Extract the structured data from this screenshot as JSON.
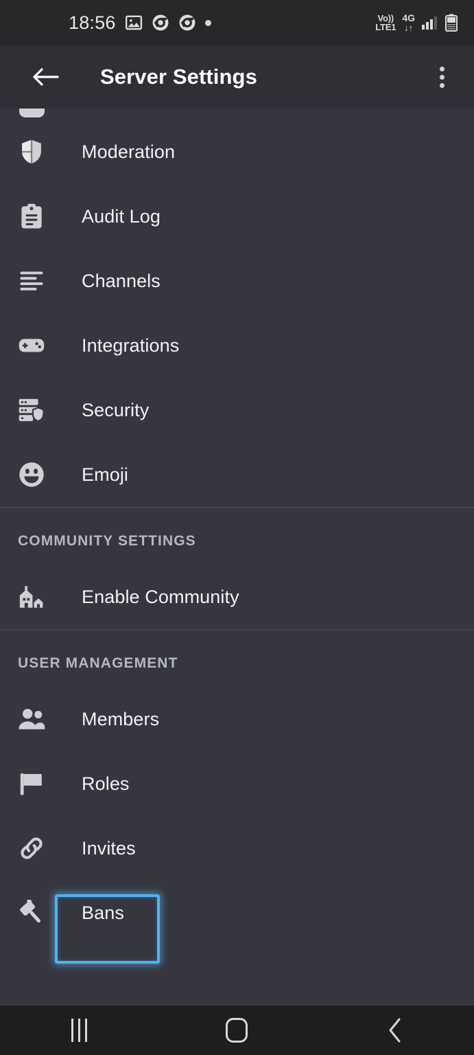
{
  "status_bar": {
    "time": "18:56",
    "icons": [
      "photo-icon",
      "chrome-icon",
      "chrome-icon",
      "dot-indicator"
    ],
    "carrier_line1": "Vo))",
    "carrier_line2": "LTE1",
    "network_type": "4G",
    "data_arrows": "↓↑",
    "signal": "signal-bars-icon",
    "battery": "battery-icon"
  },
  "header": {
    "back_icon": "arrow-left-icon",
    "title": "Server Settings",
    "overflow_icon": "more-vertical-icon"
  },
  "list": {
    "top_items": [
      {
        "label": "Moderation",
        "icon": "shield-icon"
      },
      {
        "label": "Audit Log",
        "icon": "clipboard-icon"
      },
      {
        "label": "Channels",
        "icon": "list-lines-icon"
      },
      {
        "label": "Integrations",
        "icon": "gamepad-icon"
      },
      {
        "label": "Security",
        "icon": "server-shield-icon"
      },
      {
        "label": "Emoji",
        "icon": "smiley-icon"
      }
    ],
    "community_section": {
      "header": "COMMUNITY SETTINGS",
      "items": [
        {
          "label": "Enable Community",
          "icon": "buildings-icon"
        }
      ]
    },
    "user_management_section": {
      "header": "USER MANAGEMENT",
      "items": [
        {
          "label": "Members",
          "icon": "people-icon",
          "highlighted": false
        },
        {
          "label": "Roles",
          "icon": "flag-icon",
          "highlighted": true
        },
        {
          "label": "Invites",
          "icon": "link-chain-icon",
          "highlighted": false
        },
        {
          "label": "Bans",
          "icon": "hammer-icon",
          "highlighted": false
        }
      ]
    }
  },
  "nav_bar": {
    "recents_label": "recents-button",
    "home_label": "home-button",
    "back_label": "back-button"
  },
  "colors": {
    "background": "#36363f",
    "header_bg": "#2f3036",
    "status_bg": "#28282a",
    "nav_bg": "#1d1e20",
    "text_primary": "#f2f3f5",
    "text_secondary": "#b6b8be",
    "icon_fill": "#cfd0d3",
    "highlight": "#4fb2f0",
    "divider": "#42434d"
  }
}
